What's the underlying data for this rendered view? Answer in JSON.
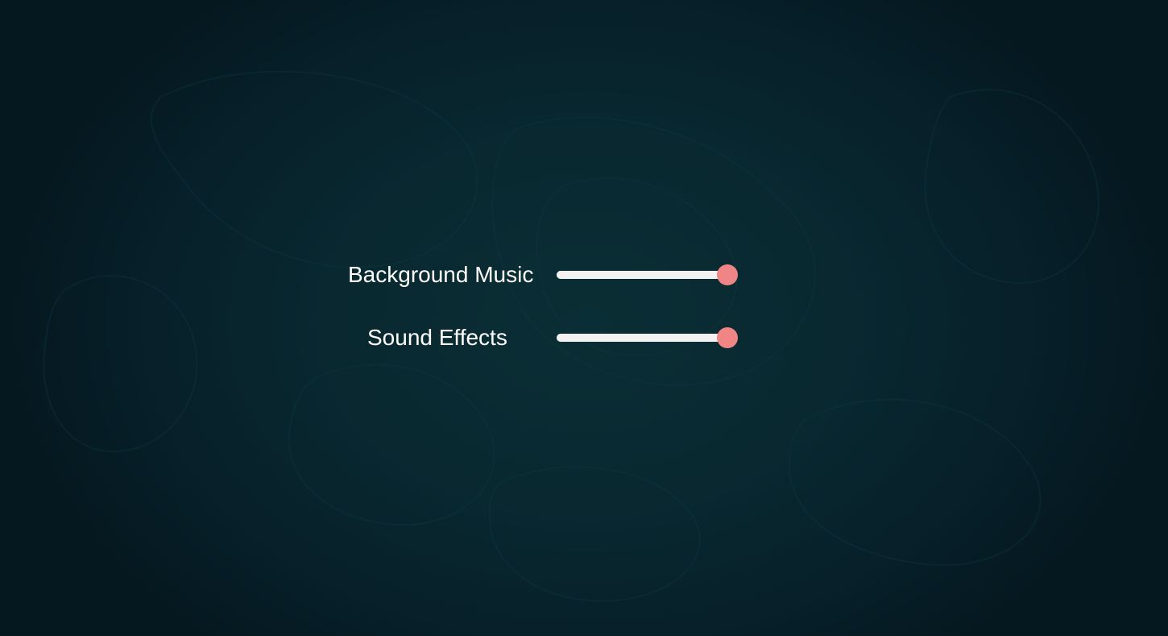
{
  "settings": {
    "music": {
      "label": "Background Music",
      "value": 1.0
    },
    "effects": {
      "label": "Sound Effects",
      "value": 1.0
    }
  },
  "colors": {
    "background": "#082228",
    "text": "#ffffff",
    "track": "#ffffff",
    "thumb": "#f08585"
  }
}
